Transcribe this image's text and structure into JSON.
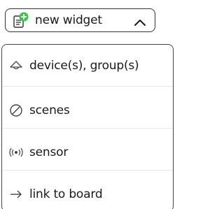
{
  "trigger": {
    "label": "new widget",
    "icon": "add-widget-icon",
    "chevron": "chevron-up-icon",
    "accent_color": "#2ecc40"
  },
  "menu": {
    "items": [
      {
        "label": "device(s), group(s)",
        "icon": "lamp-icon"
      },
      {
        "label": "scenes",
        "icon": "scene-icon"
      },
      {
        "label": "sensor",
        "icon": "sensor-icon"
      },
      {
        "label": "link to board",
        "icon": "arrow-right-icon"
      }
    ]
  }
}
